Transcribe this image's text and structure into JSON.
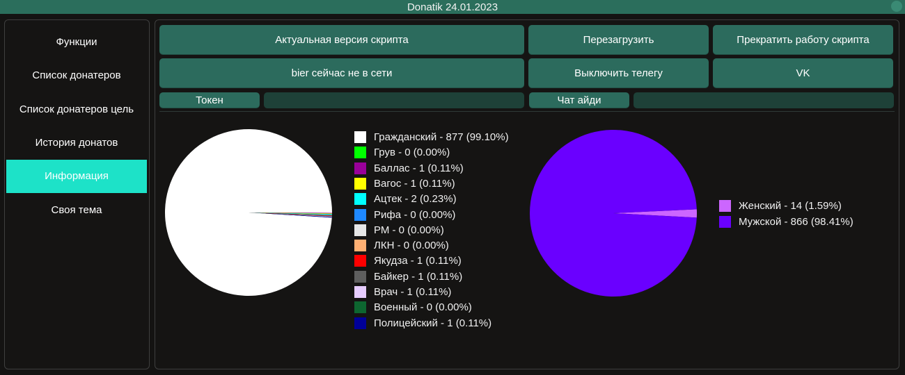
{
  "window": {
    "title": "Donatik 24.01.2023"
  },
  "sidebar": {
    "items": [
      {
        "label": "Функции",
        "active": false
      },
      {
        "label": "Список донатеров",
        "active": false
      },
      {
        "label": "Список донатеров цель",
        "active": false
      },
      {
        "label": "История донатов",
        "active": false
      },
      {
        "label": "Информация",
        "active": true
      },
      {
        "label": "Своя тема",
        "active": false
      }
    ]
  },
  "toolbar": {
    "script_version_label": "Актуальная версия скрипта",
    "reload_label": "Перезагрузить",
    "stop_script_label": "Прекратить работу скрипта",
    "user_status_label": "bier сейчас не в сети",
    "disable_telegram_label": "Выключить телегу",
    "vk_label": "VK",
    "token_label": "Токен",
    "token_value": "",
    "chat_id_label": "Чат айди",
    "chat_id_value": ""
  },
  "colors": {
    "accent": "#1de2c8",
    "button": "#2c6b5d",
    "titlebar": "#2b6e5c"
  },
  "chart_data": [
    {
      "type": "pie",
      "legend_position": "right",
      "slices": [
        {
          "label": "Гражданский - 877 (99.10%)",
          "value": 877,
          "color": "#ffffff"
        },
        {
          "label": "Грув - 0 (0.00%)",
          "value": 0,
          "color": "#00ff00"
        },
        {
          "label": "Баллас - 1 (0.11%)",
          "value": 1,
          "color": "#990099"
        },
        {
          "label": "Вагос - 1 (0.11%)",
          "value": 1,
          "color": "#ffff00"
        },
        {
          "label": "Ацтек - 2 (0.23%)",
          "value": 2,
          "color": "#00ffff"
        },
        {
          "label": "Рифа - 0 (0.00%)",
          "value": 0,
          "color": "#1e88ff"
        },
        {
          "label": "РМ - 0 (0.00%)",
          "value": 0,
          "color": "#e6e6e6"
        },
        {
          "label": "ЛКН - 0 (0.00%)",
          "value": 0,
          "color": "#ffb073"
        },
        {
          "label": "Якудза - 1 (0.11%)",
          "value": 1,
          "color": "#ff0000"
        },
        {
          "label": "Байкер - 1 (0.11%)",
          "value": 1,
          "color": "#5e5e5e"
        },
        {
          "label": "Врач - 1 (0.11%)",
          "value": 1,
          "color": "#e6ccff"
        },
        {
          "label": "Военный - 0 (0.00%)",
          "value": 0,
          "color": "#0d6630"
        },
        {
          "label": "Полицейский - 1 (0.11%)",
          "value": 1,
          "color": "#000099"
        }
      ]
    },
    {
      "type": "pie",
      "legend_position": "right",
      "slices": [
        {
          "label": "Женский - 14 (1.59%)",
          "value": 14,
          "color": "#cc66ff"
        },
        {
          "label": "Мужской - 866 (98.41%)",
          "value": 866,
          "color": "#6a00ff"
        }
      ]
    }
  ]
}
